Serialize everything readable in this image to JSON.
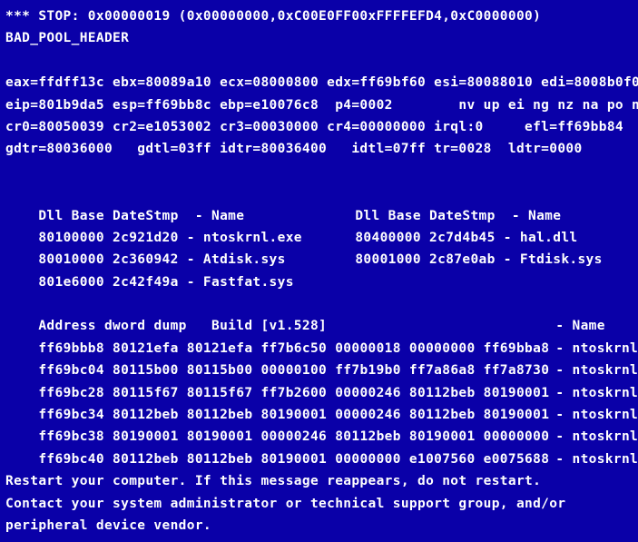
{
  "screen": {
    "kind": "windows-bsod",
    "background_color": "#0a00a8",
    "text_color": "#ffffff"
  },
  "stop": {
    "line1": "*** STOP: 0x00000019 (0x00000000,0xC00E0FF00xFFFFEFD4,0xC0000000)",
    "code": "0x00000019",
    "parameters": "(0x00000000,0xC00E0FF00xFFFFEFD4,0xC0000000)",
    "name": "BAD_POOL_HEADER"
  },
  "registers": {
    "row1": "eax=ffdff13c ebx=80089a10 ecx=08000800 edx=ff69bf60 esi=80088010 edi=8008b0f0",
    "row2": "eip=801b9da5 esp=ff69bb8c ebp=e10076c8  p4=0002        nv up ei ng nz na po nc",
    "row3": "cr0=80050039 cr2=e1053002 cr3=00030000 cr4=00000000 irql:0     efl=ff69bb84",
    "row4": "gdtr=80036000   gdtl=03ff idtr=80036400   idtl=07ff tr=0028  ldtr=0000"
  },
  "dll_table": {
    "header_left": "Dll Base DateStmp  - Name",
    "header_right": "Dll Base DateStmp  - Name",
    "left_rows": [
      "80100000 2c921d20 - ntoskrnl.exe",
      "80010000 2c360942 - Atdisk.sys",
      "801e6000 2c42f49a - Fastfat.sys"
    ],
    "right_rows": [
      "80400000 2c7d4b45 - hal.dll",
      "80001000 2c87e0ab - Ftdisk.sys",
      ""
    ]
  },
  "dump": {
    "header": "Address dword dump   Build [v1.528]",
    "header_name": "- Name",
    "rows": [
      {
        "data": "ff69bbb8 80121efa 80121efa ff7b6c50 00000018 00000000 ff69bba8",
        "name": "- ntoskrnl.exe"
      },
      {
        "data": "ff69bc04 80115b00 80115b00 00000100 ff7b19b0 ff7a86a8 ff7a8730",
        "name": "- ntoskrnl.exe"
      },
      {
        "data": "ff69bc28 80115f67 80115f67 ff7b2600 00000246 80112beb 80190001",
        "name": "- ntoskrnl.exe"
      },
      {
        "data": "ff69bc34 80112beb 80112beb 80190001 00000246 80112beb 80190001",
        "name": "- ntoskrnl.exe"
      },
      {
        "data": "ff69bc38 80190001 80190001 00000246 80112beb 80190001 00000000",
        "name": "- ntoskrnl.exe"
      },
      {
        "data": "ff69bc40 80112beb 80112beb 80190001 00000000 e1007560 e0075688",
        "name": "- ntoskrnl.exe"
      }
    ]
  },
  "footer": {
    "line1": "Restart your computer. If this message reappears, do not restart.",
    "line2": "Contact your system administrator or technical support group, and/or",
    "line3": "peripheral device vendor."
  }
}
